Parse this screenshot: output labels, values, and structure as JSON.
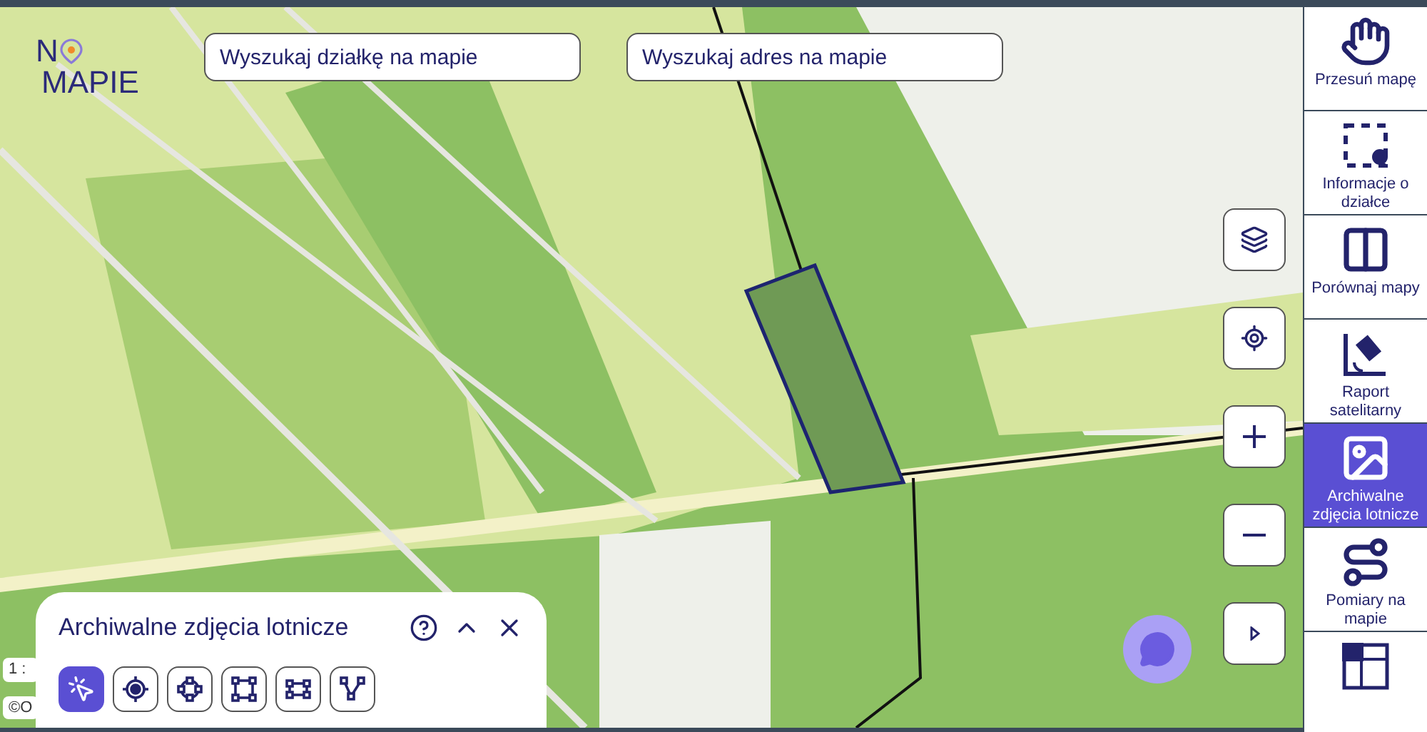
{
  "logo": {
    "top": "N",
    "bottom": "MAPIE"
  },
  "search_fields": [
    {
      "placeholder": "Wyszukaj działkę na mapie"
    },
    {
      "placeholder": "Wyszukaj adres na mapie"
    }
  ],
  "map_controls": [
    {
      "kind": "layers"
    },
    {
      "kind": "locate"
    },
    {
      "kind": "zoom_in"
    },
    {
      "kind": "zoom_out"
    },
    {
      "kind": "expand"
    }
  ],
  "scale": "1 :",
  "attribution": "©O",
  "panel": {
    "title": "Archiwalne zdjęcia lotnicze",
    "tools": [
      {
        "kind": "pointer",
        "selected": true
      },
      {
        "kind": "point",
        "selected": false
      },
      {
        "kind": "circle",
        "selected": false
      },
      {
        "kind": "square",
        "selected": false
      },
      {
        "kind": "rectangle",
        "selected": false
      },
      {
        "kind": "line",
        "selected": false
      }
    ]
  },
  "sidebar": {
    "items": [
      {
        "kind": "hand",
        "label": "Przesuń mapę",
        "selected": false
      },
      {
        "kind": "info",
        "label": "Informacje o działce",
        "selected": false
      },
      {
        "kind": "compare",
        "label": "Porównaj mapy",
        "selected": false
      },
      {
        "kind": "satellite",
        "label": "Raport satelitarny",
        "selected": false
      },
      {
        "kind": "photo",
        "label": "Archiwalne zdjęcia lotnicze",
        "selected": true
      },
      {
        "kind": "measure",
        "label": "Pomiary na mapie",
        "selected": false
      },
      {
        "kind": "grid",
        "selected": false
      }
    ]
  }
}
